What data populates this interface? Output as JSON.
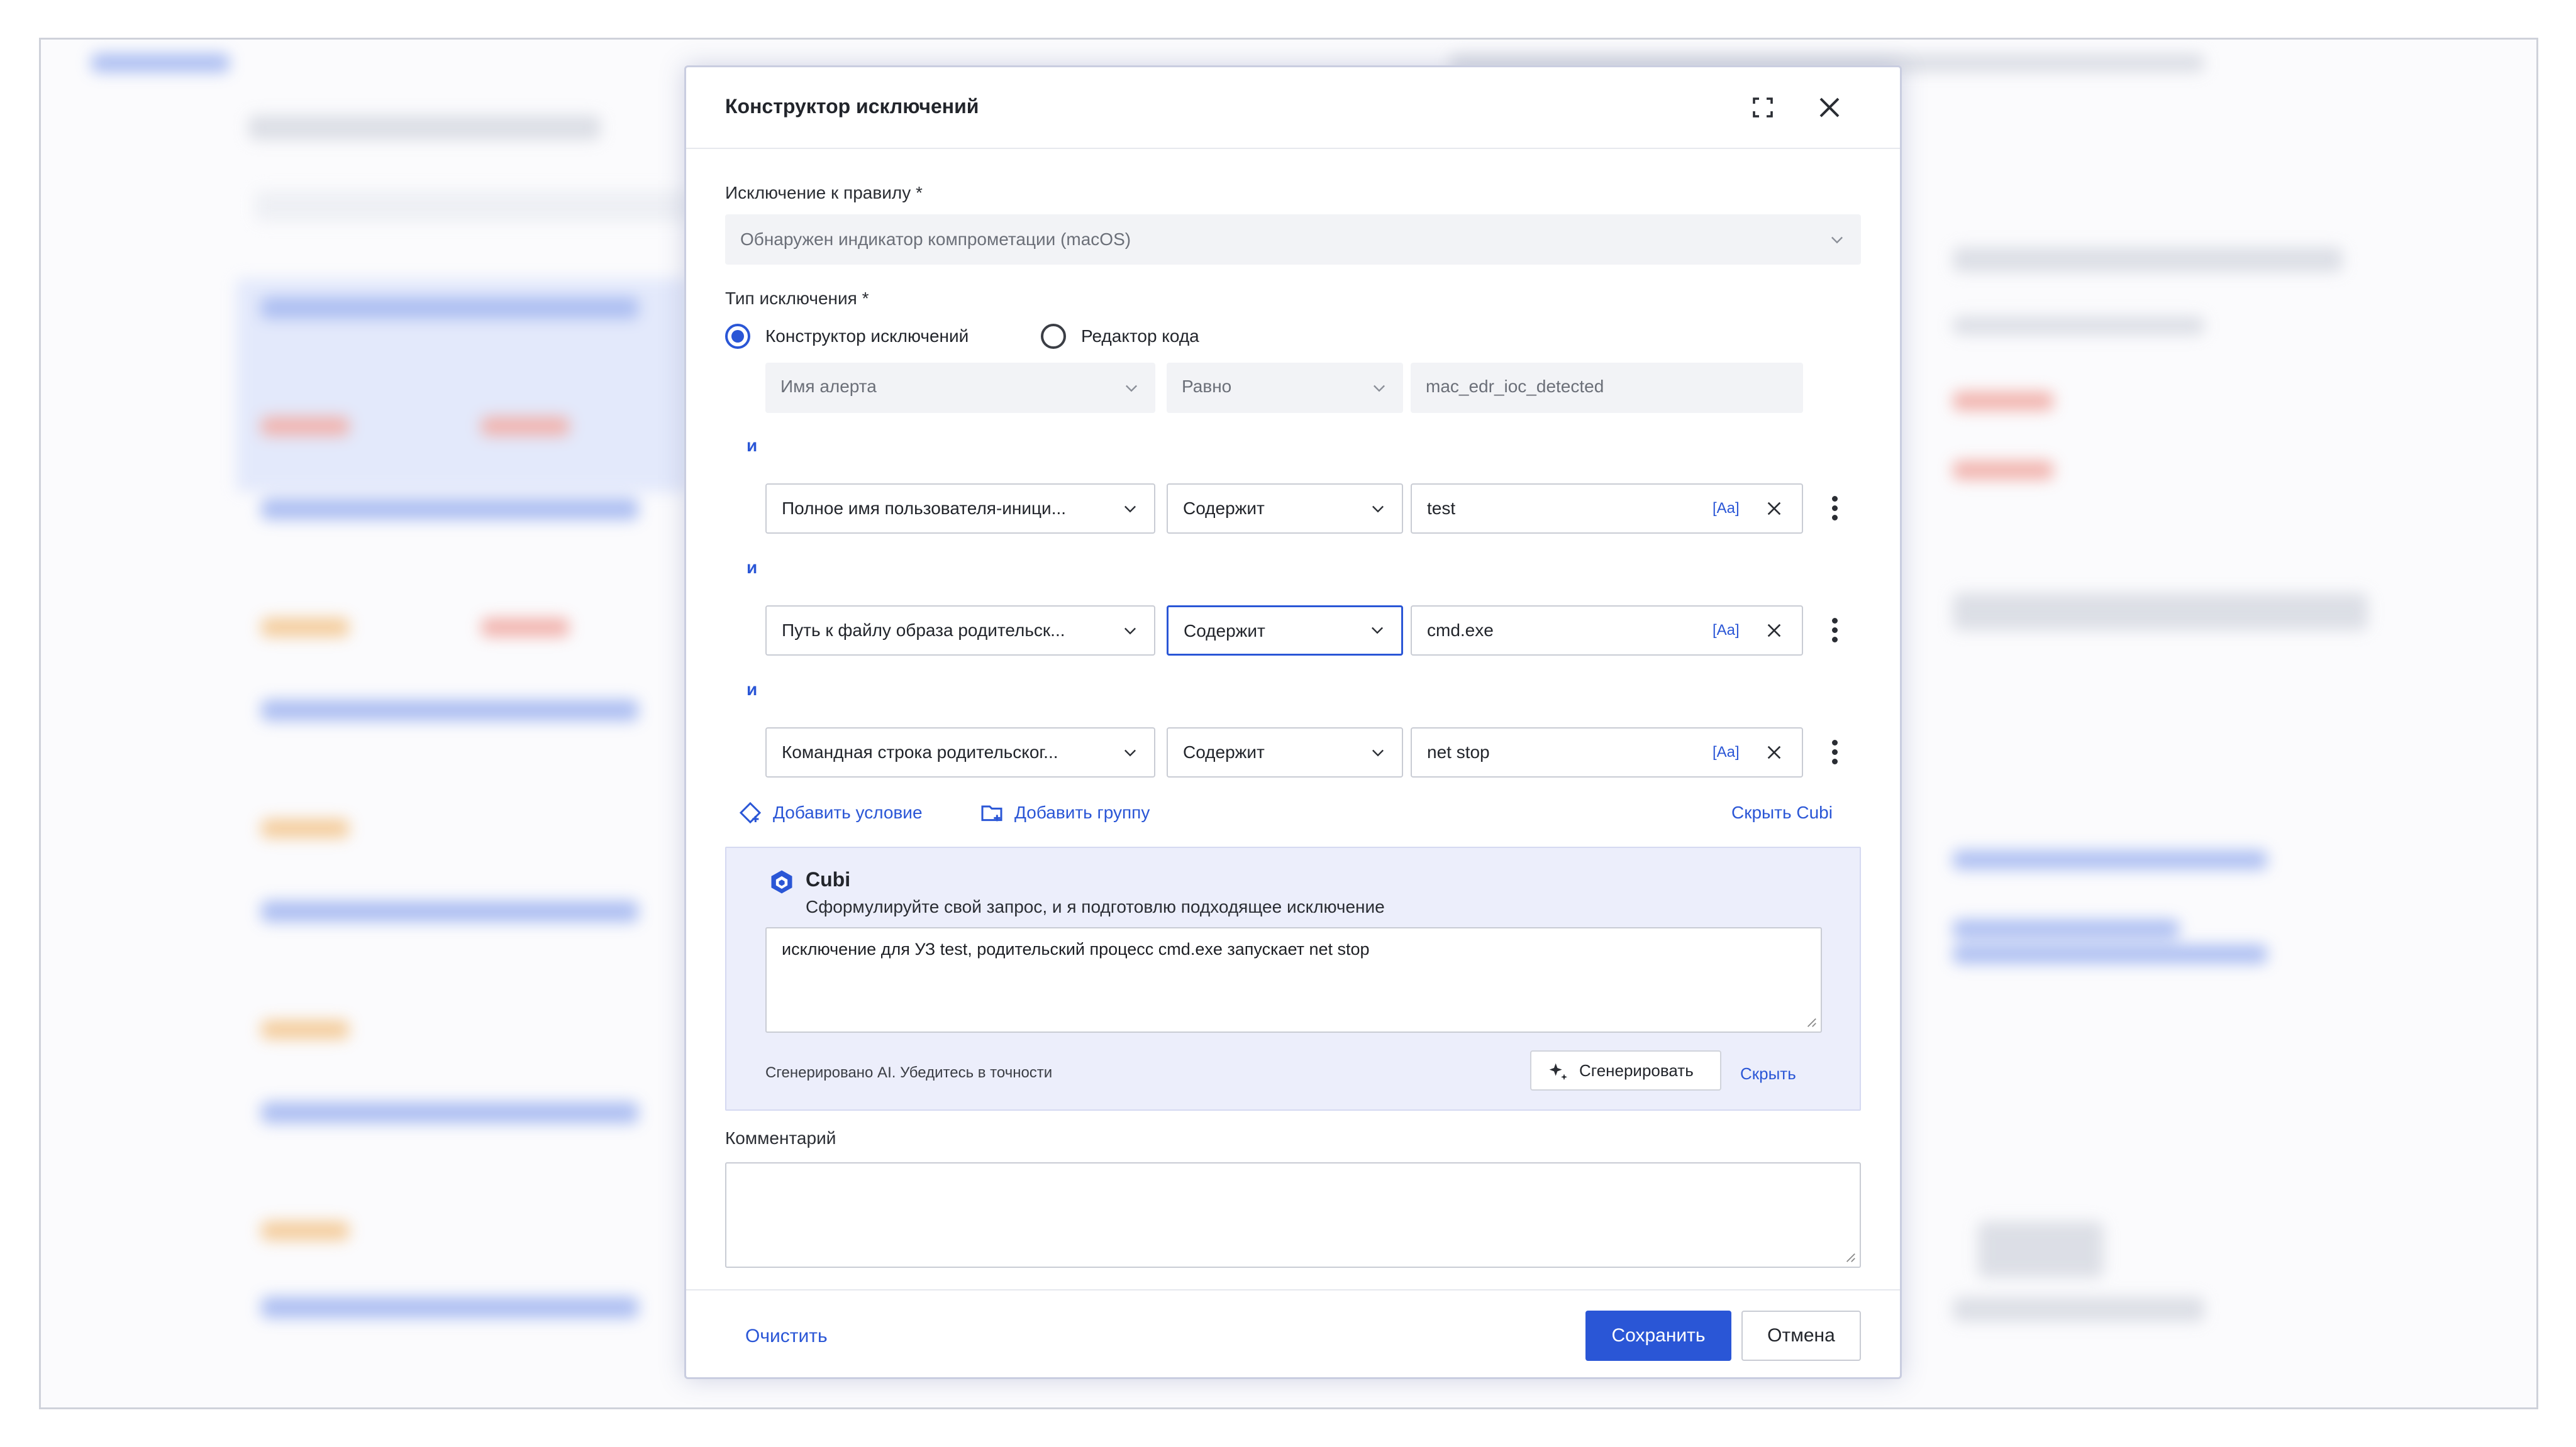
{
  "modal": {
    "title": "Конструктор исключений",
    "rule_label": "Исключение к правилу *",
    "rule_value": "Обнаружен индикатор компрометации (macOS)",
    "type_label": "Тип исключения *",
    "type_options": [
      {
        "label": "Конструктор исключений",
        "selected": true
      },
      {
        "label": "Редактор кода",
        "selected": false
      }
    ],
    "and_label": "и",
    "conditions": [
      {
        "field": "Имя алерта",
        "operator": "Равно",
        "value": "mac_edr_ioc_detected",
        "editable": false
      },
      {
        "field": "Полное имя пользователя-иници...",
        "operator": "Содержит",
        "value": "test",
        "case_tag": "[Aa]",
        "editable": true
      },
      {
        "field": "Путь к файлу образа родительск...",
        "operator": "Содержит",
        "value": "cmd.exe",
        "case_tag": "[Aa]",
        "editable": true
      },
      {
        "field": "Командная строка родительског...",
        "operator": "Содержит",
        "value": "net stop",
        "case_tag": "[Aa]",
        "editable": true
      }
    ],
    "add_condition": "Добавить условие",
    "add_group": "Добавить группу",
    "hide_cubi": "Скрыть Cubi",
    "cubi": {
      "title": "Cubi",
      "subtitle": "Сформулируйте свой запрос, и я подготовлю подходящее исключение",
      "prompt": "исключение для УЗ test, родительский процесс cmd.exe запускает net stop",
      "note": "Сгенерировано AI. Убедитесь в точности",
      "generate": "Сгенерировать",
      "hide": "Скрыть"
    },
    "comment_label": "Комментарий",
    "comment_value": "",
    "clear": "Очистить",
    "save": "Сохранить",
    "cancel": "Отмена"
  },
  "colors": {
    "accent": "#2a56d6",
    "cubi_panel": "#eceefb"
  }
}
